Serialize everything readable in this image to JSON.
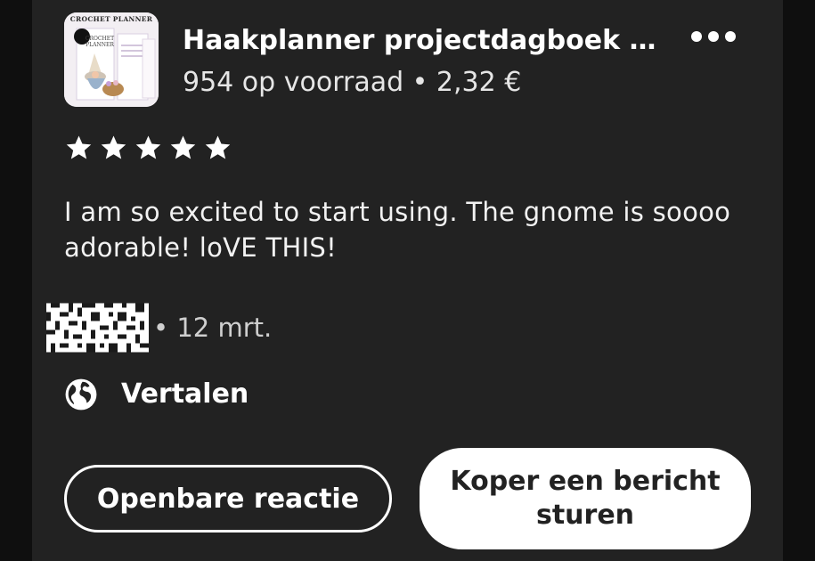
{
  "product": {
    "thumbnail_caption": "CROCHET PLANNER",
    "title": "Haakplanner projectdagboek -...",
    "stock_price": "954 op voorraad • 2,32 €"
  },
  "review": {
    "rating": 5,
    "rating_max": 5,
    "text": "I am so excited to start using. The gnome is soooo adorable! loVE THIS!",
    "date": "• 12 mrt."
  },
  "translate": {
    "label": "Vertalen"
  },
  "actions": {
    "public_reply_label": "Openbare reactie",
    "message_buyer_label": "Koper een bericht sturen"
  },
  "colors": {
    "background": "#0f0f0f",
    "card": "#222222",
    "text": "#ffffff",
    "secondary_text": "#cfcfcf"
  }
}
